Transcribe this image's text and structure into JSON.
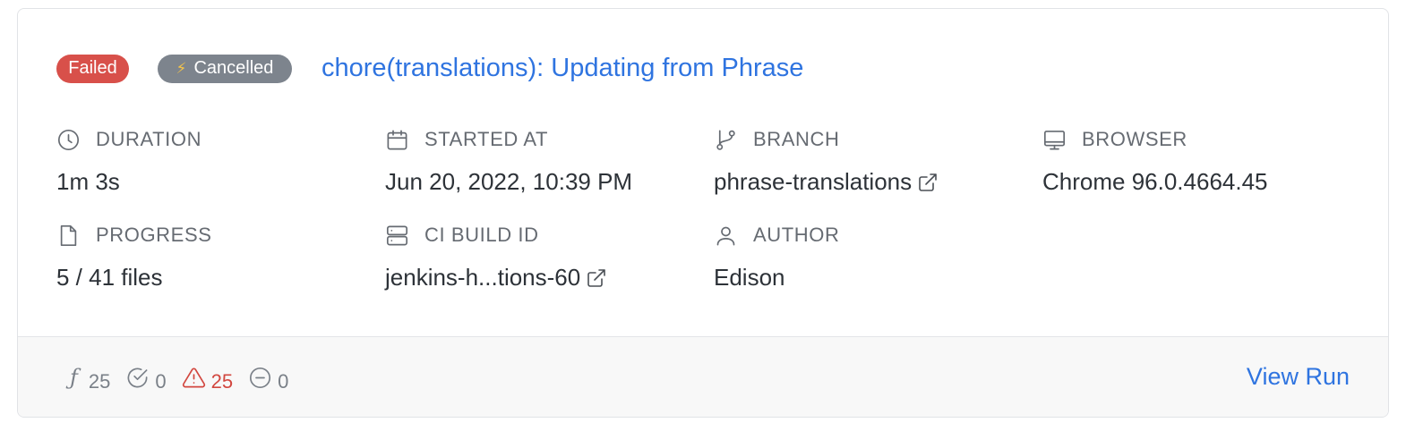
{
  "run": {
    "status_badge": "Failed",
    "cancel_badge": "Cancelled",
    "title": "chore(translations): Updating from Phrase"
  },
  "meta": {
    "duration": {
      "label": "DURATION",
      "value": "1m 3s",
      "icon": "clock-icon"
    },
    "started_at": {
      "label": "STARTED AT",
      "value": "Jun 20, 2022, 10:39 PM",
      "icon": "calendar-icon"
    },
    "branch": {
      "label": "BRANCH",
      "value": "phrase-translations",
      "icon": "git-branch-icon"
    },
    "browser": {
      "label": "BROWSER",
      "value": "Chrome 96.0.4664.45",
      "icon": "monitor-icon"
    },
    "progress": {
      "label": "PROGRESS",
      "value": "5 / 41 files",
      "icon": "file-icon"
    },
    "ci_build_id": {
      "label": "CI BUILD ID",
      "value": "jenkins-h...tions-60",
      "icon": "server-icon"
    },
    "author": {
      "label": "AUTHOR",
      "value": "Edison",
      "icon": "user-icon"
    }
  },
  "stats": {
    "functions": "25",
    "passed": "0",
    "failed": "25",
    "skipped": "0"
  },
  "footer": {
    "view_run_label": "View Run"
  },
  "colors": {
    "failed_badge": "#d8504a",
    "cancelled_badge": "#7d848d",
    "link": "#2f74e0",
    "warning": "#d2473f"
  }
}
